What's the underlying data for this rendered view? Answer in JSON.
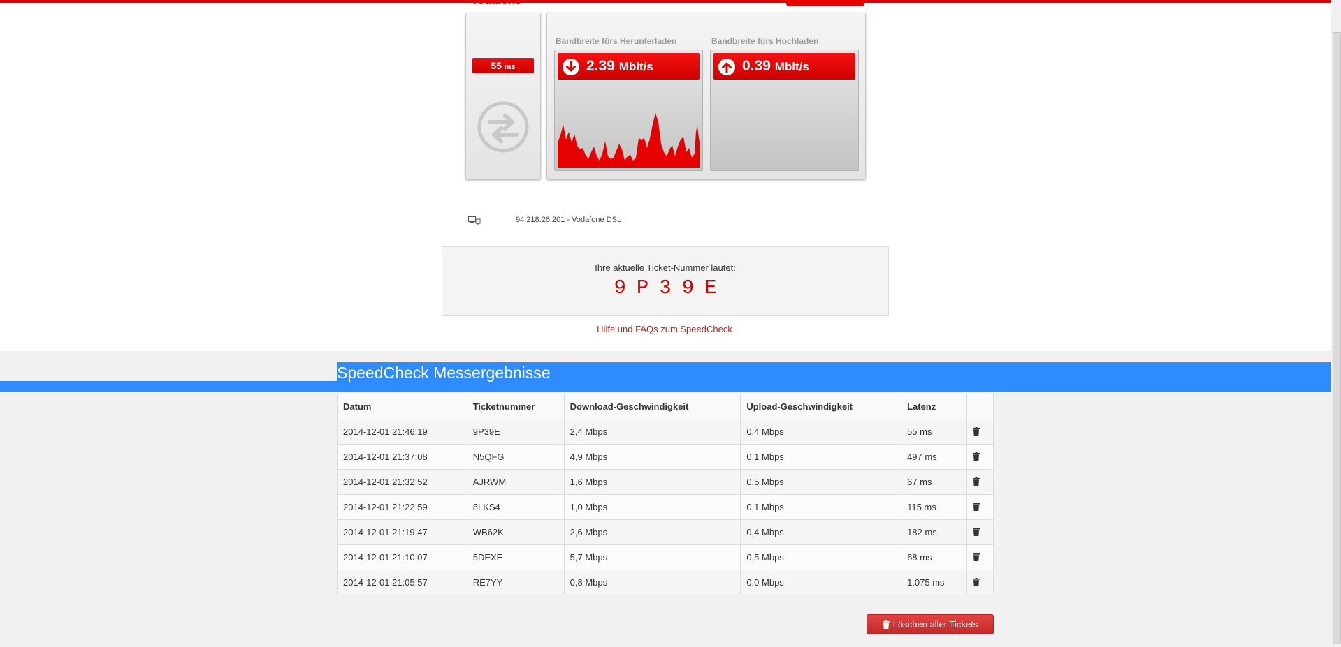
{
  "header": {
    "brand": "Vodafone",
    "top_button_label": ""
  },
  "latency": {
    "value": "55",
    "unit": "ms"
  },
  "download": {
    "label": "Bandbreite fürs Herunterladen",
    "value": "2.39",
    "unit": "Mbit/s"
  },
  "upload": {
    "label": "Bandbreite fürs Hochladen",
    "value": "0.39",
    "unit": "Mbit/s"
  },
  "connection": {
    "text": "94.218.26.201 - Vodafone DSL"
  },
  "ticket": {
    "label": "Ihre aktuelle Ticket-Nummer lautet:",
    "number": "9P39E"
  },
  "help_link": "Hilfe und FAQs zum SpeedCheck",
  "results": {
    "title": "SpeedCheck Messergebnisse",
    "columns": [
      "Datum",
      "Ticketnummer",
      "Download-Geschwindigkeit",
      "Upload-Geschwindigkeit",
      "Latenz",
      ""
    ],
    "rows": [
      [
        "2014-12-01 21:46:19",
        "9P39E",
        "2,4 Mbps",
        "0,4 Mbps",
        "55 ms"
      ],
      [
        "2014-12-01 21:37:08",
        "N5QFG",
        "4,9 Mbps",
        "0,1 Mbps",
        "497 ms"
      ],
      [
        "2014-12-01 21:32:52",
        "AJRWM",
        "1,6 Mbps",
        "0,5 Mbps",
        "67 ms"
      ],
      [
        "2014-12-01 21:22:59",
        "8LKS4",
        "1,0 Mbps",
        "0,1 Mbps",
        "115 ms"
      ],
      [
        "2014-12-01 21:19:47",
        "WB62K",
        "2,6 Mbps",
        "0,4 Mbps",
        "182 ms"
      ],
      [
        "2014-12-01 21:10:07",
        "5DEXE",
        "5,7 Mbps",
        "0,5 Mbps",
        "68 ms"
      ],
      [
        "2014-12-01 21:05:57",
        "RE7YY",
        "0,8 Mbps",
        "0,0 Mbps",
        "1.075 ms"
      ]
    ]
  },
  "delete_all_label": "Löschen aller Tickets",
  "icons": {
    "download": "arrow-down-circle-icon",
    "upload": "arrow-up-circle-icon",
    "latency": "transfer-arrows-icon",
    "connection": "computer-network-icon",
    "row_delete": "trash-icon"
  },
  "colors": {
    "brand_red": "#e60000",
    "title_blue": "#2e8cff",
    "link_red": "#c41e1e"
  }
}
